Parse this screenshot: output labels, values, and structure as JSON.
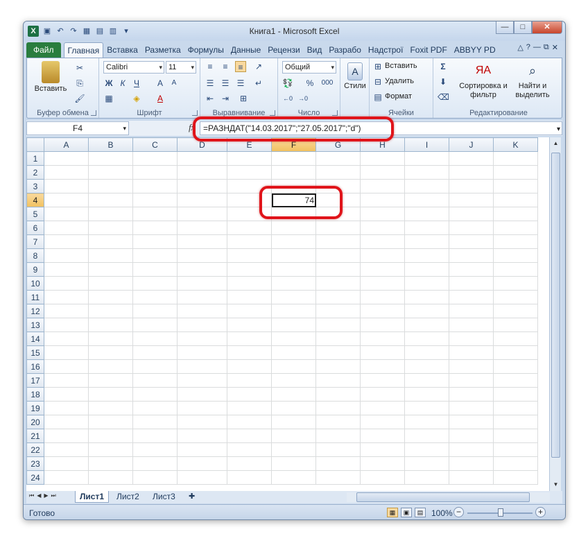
{
  "window": {
    "title": "Книга1 - Microsoft Excel",
    "app_icon": "X",
    "controls": {
      "minimize": "—",
      "maximize": "□",
      "close": "✕"
    }
  },
  "quick_access": [
    "save-icon",
    "undo-icon",
    "redo-icon"
  ],
  "ribbon": {
    "tabs": [
      {
        "label": "Файл",
        "kind": "file"
      },
      {
        "label": "Главная",
        "kind": "active"
      },
      {
        "label": "Вставка"
      },
      {
        "label": "Разметка"
      },
      {
        "label": "Формулы"
      },
      {
        "label": "Данные"
      },
      {
        "label": "Рецензи"
      },
      {
        "label": "Вид"
      },
      {
        "label": "Разрабо"
      },
      {
        "label": "Надстрої"
      },
      {
        "label": "Foxit PDF"
      },
      {
        "label": "ABBYY PD"
      }
    ],
    "groups": {
      "clipboard": {
        "label": "Буфер обмена",
        "paste": "Вставить"
      },
      "font": {
        "label": "Шрифт",
        "font_name": "Calibri",
        "font_size": "11",
        "bold": "Ж",
        "italic": "К",
        "underline": "Ч",
        "grow": "A",
        "color": "A"
      },
      "alignment": {
        "label": "Выравнивание"
      },
      "number": {
        "label": "Число",
        "format": "Общий",
        "percent": "%",
        "thousands": "000"
      },
      "styles": {
        "label": "Стили"
      },
      "cells": {
        "label": "Ячейки",
        "insert": "Вставить",
        "delete": "Удалить",
        "format": "Формат"
      },
      "editing": {
        "label": "Редактирование",
        "sort": "Сортировка и фильтр",
        "find": "Найти и выделить",
        "sum": "Σ"
      }
    }
  },
  "formula_bar": {
    "name_box": "F4",
    "fx": "fx",
    "formula": "=РАЗНДАТ(\"14.03.2017\";\"27.05.2017\";\"d\")"
  },
  "grid": {
    "columns": [
      "A",
      "B",
      "C",
      "D",
      "E",
      "F",
      "G",
      "H",
      "I",
      "J",
      "K"
    ],
    "selected_column": "F",
    "rows": [
      "1",
      "2",
      "3",
      "4",
      "5",
      "6",
      "7",
      "8",
      "9",
      "10",
      "11",
      "12",
      "13",
      "14",
      "15",
      "16",
      "17",
      "18",
      "19",
      "20",
      "21",
      "22",
      "23",
      "24"
    ],
    "selected_row": "4",
    "cells": {
      "F4": "74"
    }
  },
  "sheets": {
    "tabs": [
      "Лист1",
      "Лист2",
      "Лист3"
    ],
    "active": "Лист1"
  },
  "status": {
    "text": "Готово",
    "zoom": "100%"
  },
  "accent": {
    "highlight": "#e0141a",
    "file_tab": "#2a7d3e"
  }
}
